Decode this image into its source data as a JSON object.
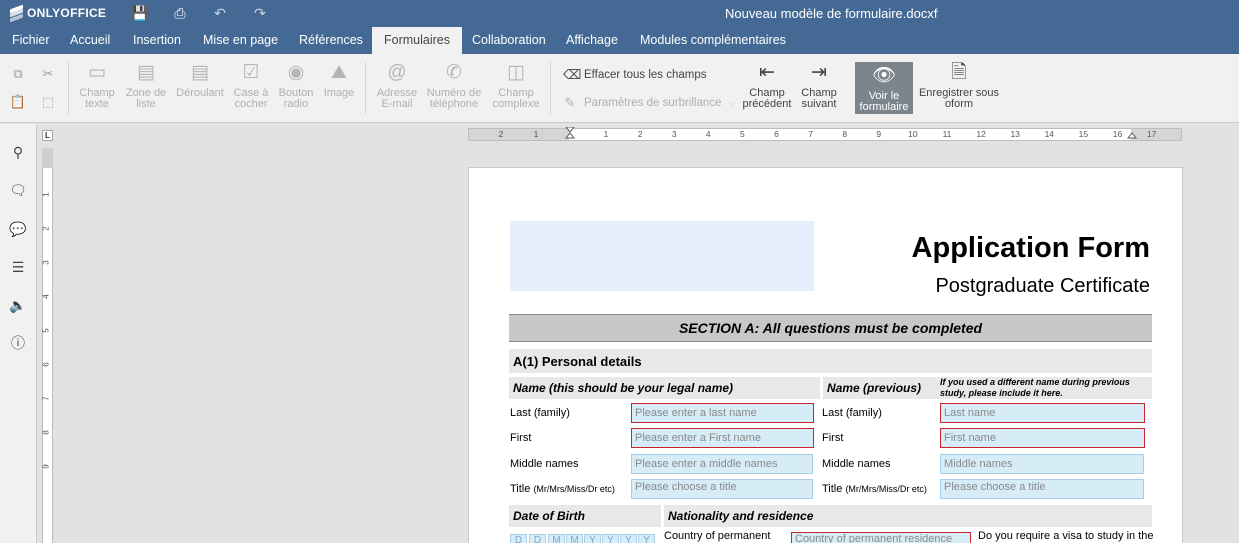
{
  "app": {
    "brand": "ONLYOFFICE",
    "document_title": "Nouveau modèle de formulaire.docxf"
  },
  "menu": {
    "tabs": [
      {
        "label": "Fichier"
      },
      {
        "label": "Accueil"
      },
      {
        "label": "Insertion"
      },
      {
        "label": "Mise en page"
      },
      {
        "label": "Références"
      },
      {
        "label": "Formulaires",
        "active": true
      },
      {
        "label": "Collaboration"
      },
      {
        "label": "Affichage"
      },
      {
        "label": "Modules complémentaires"
      }
    ]
  },
  "toolbar": {
    "text_field": "Champ texte",
    "combo_box": "Zone de liste",
    "dropdown": "Déroulant",
    "checkbox": "Case à cocher",
    "radio_button": "Bouton radio",
    "image": "Image",
    "email": "Adresse E-mail",
    "phone": "Numéro de téléphone",
    "complex_field": "Champ complexe",
    "clear_all": "Effacer tous les champs",
    "highlight_settings": "Paramètres de surbrillance",
    "prev_field": "Champ précédent",
    "next_field": "Champ suivant",
    "view_form": "Voir le formulaire",
    "save_as_oform": "Enregistrer sous oform"
  },
  "ruler": {
    "numbers": [
      "2",
      "1",
      "1",
      "2",
      "3",
      "4",
      "5",
      "6",
      "7",
      "8",
      "9",
      "10",
      "11",
      "12",
      "13",
      "14",
      "15",
      "16",
      "17"
    ]
  },
  "vruler": {
    "numbers": [
      "1",
      "2",
      "3",
      "4",
      "5",
      "6",
      "7",
      "8",
      "9"
    ]
  },
  "form": {
    "title": "Application Form",
    "subtitle": "Postgraduate Certificate",
    "section_a": "SECTION A: All questions must be completed",
    "personal_details": "A(1) Personal details",
    "name_legal": "Name (this should be your legal name)",
    "name_previous": "Name (previous)",
    "previous_note": "If you used a different name during previous study, please include it here.",
    "left": {
      "last_label": "Last (family)",
      "last_placeholder": "Please enter a last name",
      "first_label": "First",
      "first_placeholder": "Please enter a First name",
      "middle_label": "Middle names",
      "middle_placeholder": "Please enter a middle names",
      "title_label": "Title",
      "title_hint": "(Mr/Mrs/Miss/Dr etc)",
      "title_placeholder": "Please choose a title"
    },
    "right": {
      "last_label": "Last (family)",
      "last_placeholder": "Last name",
      "first_label": "First",
      "first_placeholder": "First name",
      "middle_label": "Middle names",
      "middle_placeholder": "Middle names",
      "title_label": "Title",
      "title_hint": "(Mr/Mrs/Miss/Dr etc)",
      "title_placeholder": "Please choose a title"
    },
    "dob": "Date of Birth",
    "nationality": "Nationality and residence",
    "dob_chars": [
      "D",
      "D",
      "M",
      "M",
      "Y",
      "Y",
      "Y",
      "Y"
    ],
    "country_label": "Country of permanent",
    "country_placeholder": "Country of permanent residence",
    "visa_question": "Do you require a visa to study in the"
  }
}
